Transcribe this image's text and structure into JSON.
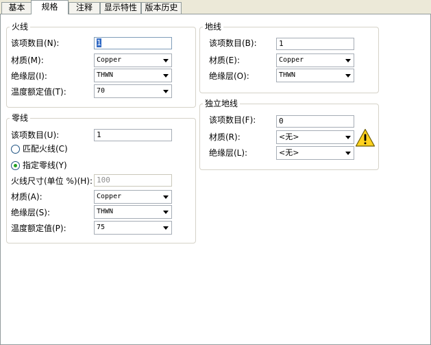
{
  "tabs": [
    {
      "label": "基本",
      "active": false
    },
    {
      "label": "规格",
      "active": true
    },
    {
      "label": "注释",
      "active": false
    },
    {
      "label": "显示特性",
      "active": false
    },
    {
      "label": "版本历史",
      "active": false
    }
  ],
  "live": {
    "title": "火线",
    "count_label": "该项数目(N):",
    "count_value": "1",
    "material_label": "材质(M):",
    "material_value": "Copper",
    "insulation_label": "绝缘层(I):",
    "insulation_value": "THWN",
    "temp_label": "温度额定值(T):",
    "temp_value": "70"
  },
  "neutral": {
    "title": "零线",
    "count_label": "该项数目(U):",
    "count_value": "1",
    "match_live_label": "匹配火线(C)",
    "specify_label": "指定零线(Y)",
    "selected_option": "specify",
    "size_label": "火线尺寸(单位 %)(H):",
    "size_value": "100",
    "material_label": "材质(A):",
    "material_value": "Copper",
    "insulation_label": "绝缘层(S):",
    "insulation_value": "THWN",
    "temp_label": "温度额定值(P):",
    "temp_value": "75"
  },
  "ground": {
    "title": "地线",
    "count_label": "该项数目(B):",
    "count_value": "1",
    "material_label": "材质(E):",
    "material_value": "Copper",
    "insulation_label": "绝缘层(O):",
    "insulation_value": "THWN"
  },
  "isolated_ground": {
    "title": "独立地线",
    "count_label": "该项数目(F):",
    "count_value": "0",
    "material_label": "材质(R):",
    "material_value": "<无>",
    "insulation_label": "绝缘层(L):",
    "insulation_value": "<无>",
    "warning_icon": "warning-triangle"
  },
  "colors": {
    "panel_bg": "#ffffff",
    "window_bg": "#ece9d8",
    "selection": "#316ac5",
    "warning": "#ffd21e"
  }
}
